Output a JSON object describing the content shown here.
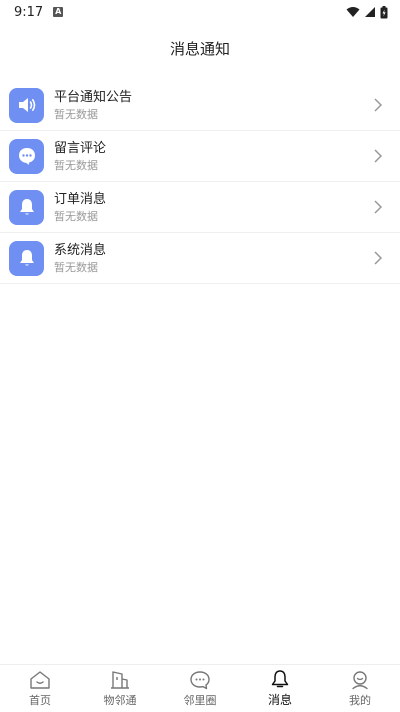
{
  "status": {
    "time": "9:17",
    "badge": "A"
  },
  "header": {
    "title": "消息通知"
  },
  "list": [
    {
      "title": "平台通知公告",
      "sub": "暂无数据",
      "icon": "speaker-icon"
    },
    {
      "title": "留言评论",
      "sub": "暂无数据",
      "icon": "chat-bubble-icon"
    },
    {
      "title": "订单消息",
      "sub": "暂无数据",
      "icon": "bell-icon"
    },
    {
      "title": "系统消息",
      "sub": "暂无数据",
      "icon": "bell-icon"
    }
  ],
  "tabs": [
    {
      "label": "首页",
      "icon": "home-icon",
      "active": false
    },
    {
      "label": "物邻通",
      "icon": "building-icon",
      "active": false
    },
    {
      "label": "邻里圈",
      "icon": "chat-icon",
      "active": false
    },
    {
      "label": "消息",
      "icon": "bell-icon",
      "active": true
    },
    {
      "label": "我的",
      "icon": "profile-icon",
      "active": false
    }
  ],
  "colors": {
    "accent": "#6f8ff3"
  }
}
